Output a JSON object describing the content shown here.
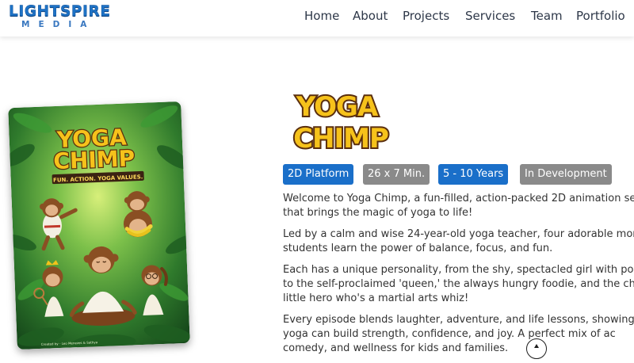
{
  "brand": {
    "name_top": "LIGHTSPIRE",
    "name_bottom": "MEDIA"
  },
  "nav": {
    "items": [
      "Home",
      "About",
      "Projects",
      "Services",
      "Team",
      "Portfolio"
    ]
  },
  "poster": {
    "title_line1": "YOGA",
    "title_line2": "CHIMP",
    "tagline": "FUN. ACTION. YOGA VALUES.",
    "credit": "Created by - Leo Menezes & Sathya"
  },
  "show": {
    "title_line1": "YOGA",
    "title_line2": "CHIMP",
    "tags": [
      {
        "label": "2D Platform",
        "color": "#1a6fc9"
      },
      {
        "label": "26 x 7 Min.",
        "color": "#8a8a8a"
      },
      {
        "label": "5 - 10 Years",
        "color": "#1a6fc9"
      },
      {
        "label": "In Development",
        "color": "#8a8a8a"
      }
    ],
    "paragraphs": [
      "Welcome to Yoga Chimp, a fun-filled, action-packed 2D animation se\nthat brings the magic of yoga to life!",
      "Led by a calm and wise 24-year-old yoga teacher, four adorable mor\nstudents learn the power of balance, focus, and fun.",
      "Each has a unique personality, from the shy, spectacled girl with pony\nto the self-proclaimed 'queen,' the always hungry foodie, and the che\nlittle hero who's a martial arts whiz!",
      "Every episode blends laughter, adventure, and life lessons, showing\nyoga can build strength, confidence, and joy. A perfect mix of ac\ncomedy, and wellness for kids and families."
    ]
  },
  "colors": {
    "brand_blue": "#1f73c6",
    "title_yellow": "#f6c21b",
    "title_outline": "#5a2e0e",
    "jungle_green": "#2f7a2c"
  }
}
